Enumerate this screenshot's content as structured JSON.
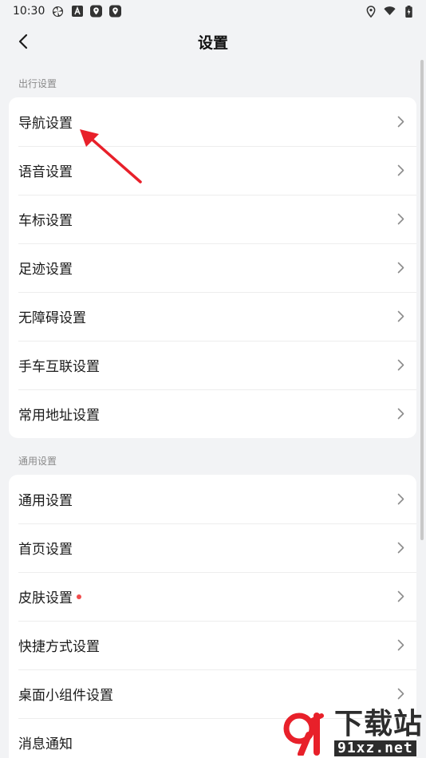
{
  "status_bar": {
    "time": "10:30"
  },
  "header": {
    "title": "设置"
  },
  "sections": [
    {
      "title": "出行设置",
      "items": [
        {
          "label": "导航设置"
        },
        {
          "label": "语音设置"
        },
        {
          "label": "车标设置"
        },
        {
          "label": "足迹设置"
        },
        {
          "label": "无障碍设置"
        },
        {
          "label": "手车互联设置"
        },
        {
          "label": "常用地址设置"
        }
      ]
    },
    {
      "title": "通用设置",
      "items": [
        {
          "label": "通用设置"
        },
        {
          "label": "首页设置"
        },
        {
          "label": "皮肤设置"
        },
        {
          "label": "快捷方式设置"
        },
        {
          "label": "桌面小组件设置"
        },
        {
          "label": "消息通知"
        }
      ]
    }
  ],
  "watermark": {
    "text": "下载站",
    "url": "91xz.net"
  },
  "colors": {
    "accent_red": "#e8202a",
    "badge_red": "#f04c4c",
    "background": "#f2f3f5"
  }
}
